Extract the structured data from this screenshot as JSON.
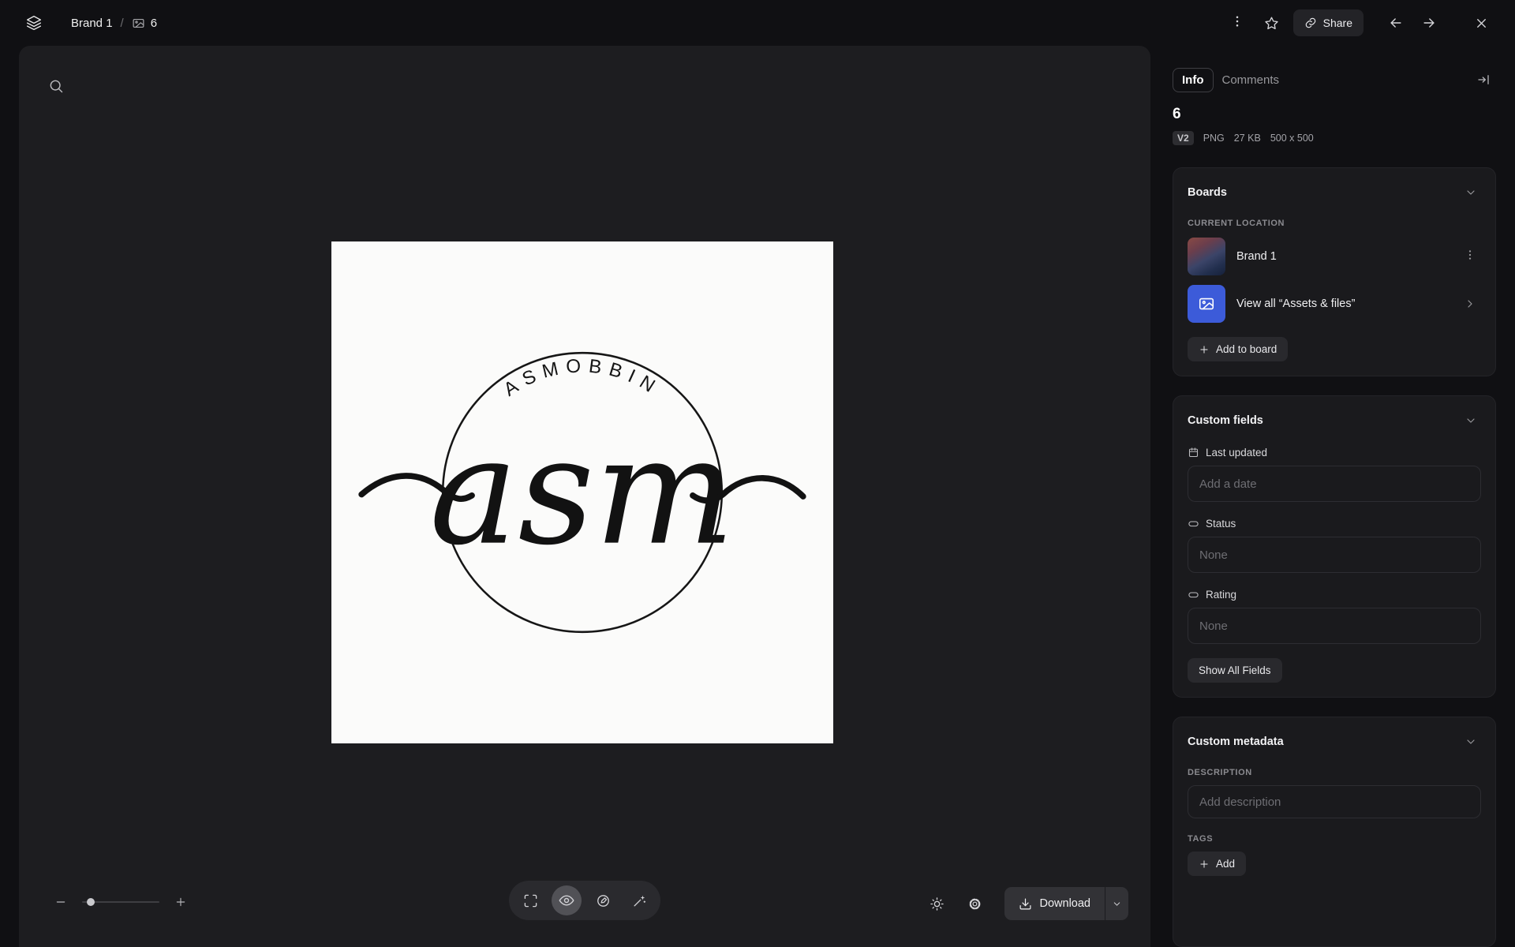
{
  "topbar": {
    "breadcrumb": {
      "parent": "Brand 1",
      "separator": "/",
      "current": "6"
    },
    "share_label": "Share"
  },
  "canvas": {
    "logo_arc_text": "ASMOBBIN",
    "logo_script_text": "asm"
  },
  "toolbar": {
    "download_label": "Download"
  },
  "panel": {
    "tabs": {
      "info": "Info",
      "comments": "Comments"
    },
    "asset": {
      "title": "6",
      "version": "V2",
      "format": "PNG",
      "filesize": "27 KB",
      "dimensions": "500 x 500"
    },
    "boards": {
      "header": "Boards",
      "current_location_label": "CURRENT LOCATION",
      "board_name": "Brand 1",
      "view_all_label": "View all “Assets & files”",
      "add_to_board_label": "Add to board"
    },
    "custom_fields": {
      "header": "Custom fields",
      "last_updated": {
        "label": "Last updated",
        "placeholder": "Add a date"
      },
      "status": {
        "label": "Status",
        "placeholder": "None"
      },
      "rating": {
        "label": "Rating",
        "placeholder": "None"
      },
      "show_all_label": "Show All Fields"
    },
    "custom_metadata": {
      "header": "Custom metadata",
      "description_label": "DESCRIPTION",
      "description_placeholder": "Add description",
      "tags_label": "TAGS",
      "add_label": "Add"
    }
  },
  "colors": {
    "accent_blue": "#3c5bd9",
    "canvas_bg": "#1d1d20",
    "panel_card_bg": "#1a1a1d"
  }
}
